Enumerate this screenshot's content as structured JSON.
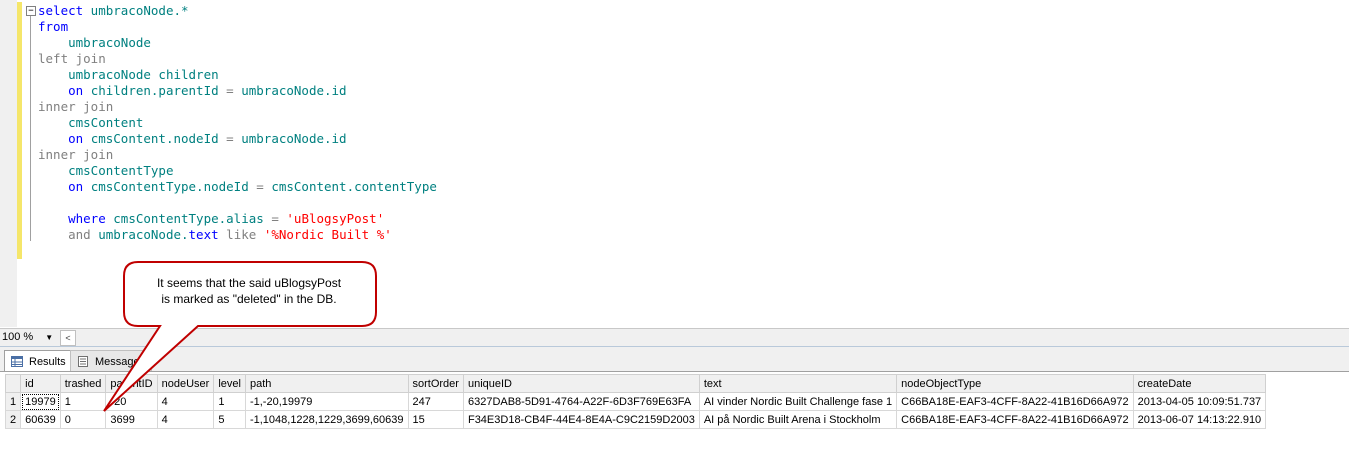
{
  "editor": {
    "collapse_glyph": "−",
    "lines": [
      {
        "indent": "",
        "parts": [
          {
            "t": "select",
            "c": "kw"
          },
          {
            "t": " umbracoNode.*",
            "c": "plain"
          }
        ]
      },
      {
        "indent": "",
        "parts": [
          {
            "t": "from",
            "c": "kw"
          }
        ]
      },
      {
        "indent": "    ",
        "parts": [
          {
            "t": "umbracoNode",
            "c": "plain"
          }
        ]
      },
      {
        "indent": "",
        "parts": [
          {
            "t": "left join",
            "c": "gray"
          }
        ]
      },
      {
        "indent": "    ",
        "parts": [
          {
            "t": "umbracoNode children",
            "c": "plain"
          }
        ]
      },
      {
        "indent": "    ",
        "parts": [
          {
            "t": "on",
            "c": "kw"
          },
          {
            "t": " children.parentId ",
            "c": "plain"
          },
          {
            "t": "=",
            "c": "gray"
          },
          {
            "t": " umbracoNode.id",
            "c": "plain"
          }
        ]
      },
      {
        "indent": "",
        "parts": [
          {
            "t": "inner join",
            "c": "gray"
          }
        ]
      },
      {
        "indent": "    ",
        "parts": [
          {
            "t": "cmsContent",
            "c": "plain"
          }
        ]
      },
      {
        "indent": "    ",
        "parts": [
          {
            "t": "on",
            "c": "kw"
          },
          {
            "t": " cmsContent.nodeId ",
            "c": "plain"
          },
          {
            "t": "=",
            "c": "gray"
          },
          {
            "t": " umbracoNode.id",
            "c": "plain"
          }
        ]
      },
      {
        "indent": "",
        "parts": [
          {
            "t": "inner join",
            "c": "gray"
          }
        ]
      },
      {
        "indent": "    ",
        "parts": [
          {
            "t": "cmsContentType",
            "c": "plain"
          }
        ]
      },
      {
        "indent": "    ",
        "parts": [
          {
            "t": "on",
            "c": "kw"
          },
          {
            "t": " cmsContentType.nodeId ",
            "c": "plain"
          },
          {
            "t": "=",
            "c": "gray"
          },
          {
            "t": " cmsContent.contentType",
            "c": "plain"
          }
        ]
      },
      {
        "indent": "",
        "parts": []
      },
      {
        "indent": "    ",
        "parts": [
          {
            "t": "where",
            "c": "kw"
          },
          {
            "t": " cmsContentType.alias ",
            "c": "plain"
          },
          {
            "t": "=",
            "c": "gray"
          },
          {
            "t": " ",
            "c": "plain"
          },
          {
            "t": "'uBlogsyPost'",
            "c": "str"
          }
        ]
      },
      {
        "indent": "    ",
        "parts": [
          {
            "t": "and",
            "c": "gray"
          },
          {
            "t": " umbracoNode.",
            "c": "plain"
          },
          {
            "t": "text",
            "c": "kw"
          },
          {
            "t": " ",
            "c": "plain"
          },
          {
            "t": "like",
            "c": "gray"
          },
          {
            "t": " ",
            "c": "plain"
          },
          {
            "t": "'%Nordic Built %'",
            "c": "str"
          }
        ]
      }
    ]
  },
  "zoom": {
    "value": "100 %",
    "arrow": "▼",
    "scroll_left": "<"
  },
  "tabs": {
    "results_label": "Results",
    "messages_label": "Messages"
  },
  "grid": {
    "columns": [
      "",
      "id",
      "trashed",
      "parentID",
      "nodeUser",
      "level",
      "path",
      "sortOrder",
      "uniqueID",
      "text",
      "nodeObjectType",
      "createDate"
    ],
    "rows": [
      [
        "1",
        "19979",
        "1",
        "-20",
        "4",
        "1",
        "-1,-20,19979",
        "247",
        "6327DAB8-5D91-4764-A22F-6D3F769E63FA",
        "AI vinder Nordic Built Challenge fase 1",
        "C66BA18E-EAF3-4CFF-8A22-41B16D66A972",
        "2013-04-05 10:09:51.737"
      ],
      [
        "2",
        "60639",
        "0",
        "3699",
        "4",
        "5",
        "-1,1048,1228,1229,3699,60639",
        "15",
        "F34E3D18-CB4F-44E4-8E4A-C9C2159D2003",
        "AI på Nordic Built Arena i Stockholm",
        "C66BA18E-EAF3-4CFF-8A22-41B16D66A972",
        "2013-06-07 14:13:22.910"
      ]
    ]
  },
  "callout": {
    "line1": "It seems that the said uBlogsyPost",
    "line2": "is marked as \"deleted\" in the DB.",
    "border_color": "#c00000"
  }
}
